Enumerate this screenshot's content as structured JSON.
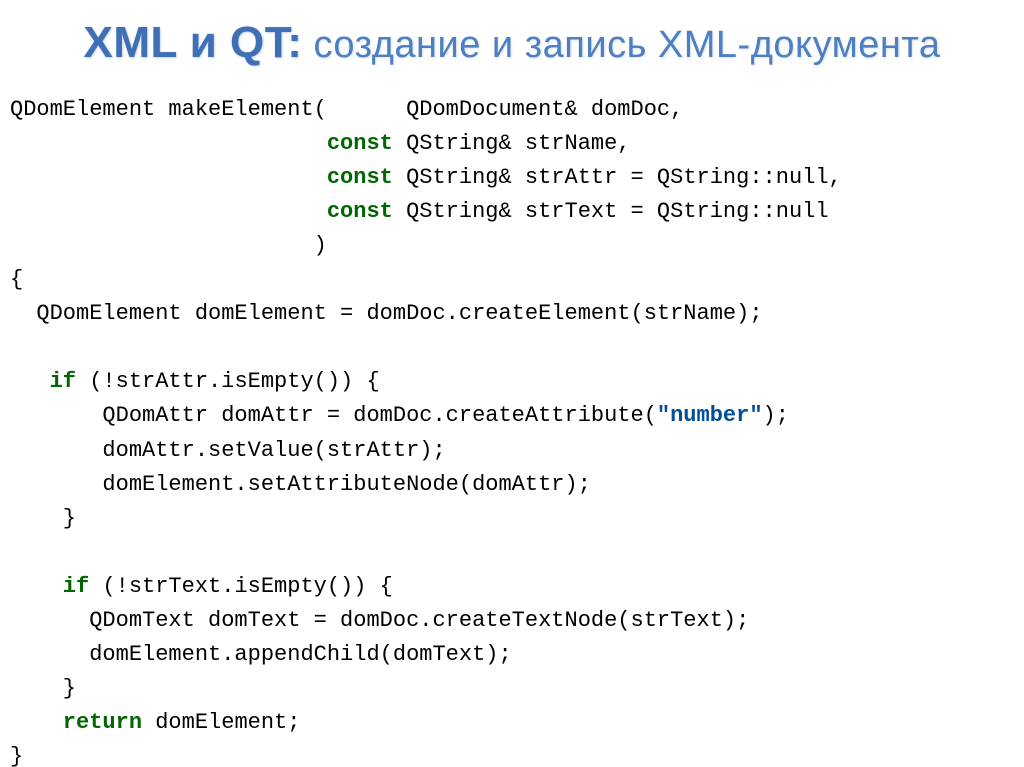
{
  "title": {
    "big": "XML и QT:",
    "small": " создание и запись XML-документа"
  },
  "code": {
    "l1a": "QDomElement makeElement(      QDomDocument& domDoc,",
    "l2_kw": "                        const",
    "l2_rest": " QString& strName,",
    "l3_kw": "                        const",
    "l3_rest": " QString& strAttr = QString::null,",
    "l4_kw": "                        const",
    "l4_rest": " QString& strText = QString::null",
    "l5": "                       )",
    "l6": "{",
    "l7": "  QDomElement domElement = domDoc.createElement(strName);",
    "l8": "",
    "l9_kw": "   if",
    "l9_rest": " (!strAttr.isEmpty()) {",
    "l10a": "       QDomAttr domAttr = domDoc.createAttribute(",
    "l10_str": "\"number\"",
    "l10b": ");",
    "l11": "       domAttr.setValue(strAttr);",
    "l12": "       domElement.setAttributeNode(domAttr);",
    "l13": "    }",
    "l14": "",
    "l15_kw": "    if",
    "l15_rest": " (!strText.isEmpty()) {",
    "l16": "      QDomText domText = domDoc.createTextNode(strText);",
    "l17": "      domElement.appendChild(domText);",
    "l18": "    }",
    "l19_kw": "    return",
    "l19_rest": " domElement;",
    "l20": "}"
  }
}
